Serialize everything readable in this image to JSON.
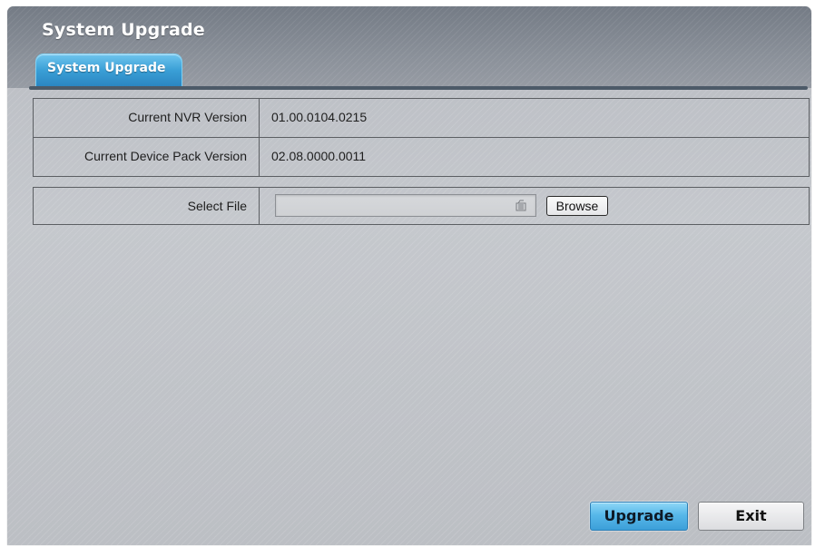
{
  "window": {
    "title": "System Upgrade"
  },
  "tabs": [
    {
      "label": "System Upgrade",
      "active": true
    }
  ],
  "info": {
    "rows": [
      {
        "label": "Current NVR Version",
        "value": "01.00.0104.0215"
      },
      {
        "label": "Current Device Pack Version",
        "value": "02.08.0000.0011"
      }
    ]
  },
  "file_select": {
    "label": "Select File",
    "value": "",
    "browse_label": "Browse"
  },
  "footer": {
    "upgrade_label": "Upgrade",
    "exit_label": "Exit"
  },
  "colors": {
    "accent": "#3c9fd9",
    "header": "#7e858f",
    "panel": "#c2c5ca"
  },
  "icons": {
    "file_input": "file-icon"
  }
}
